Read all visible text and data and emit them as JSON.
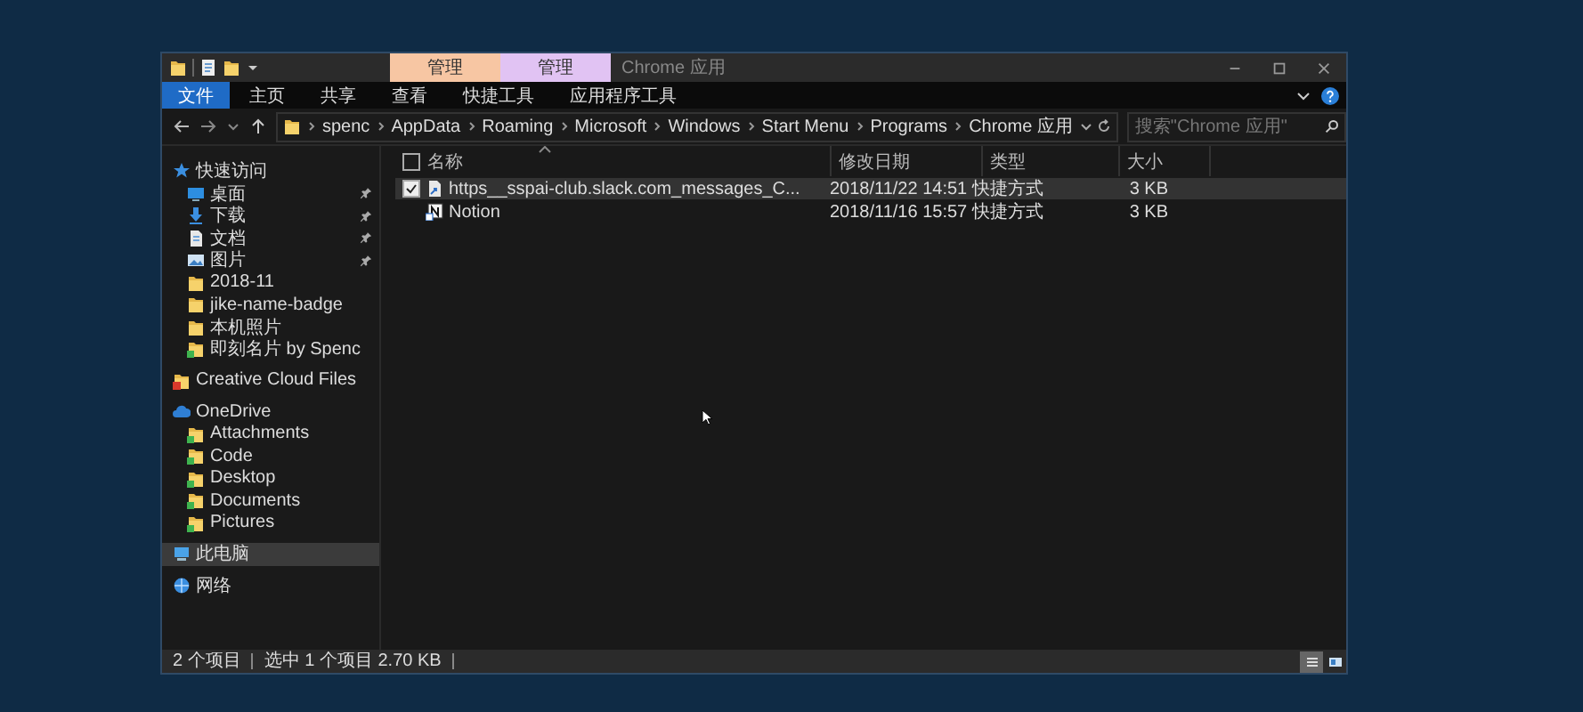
{
  "window": {
    "contextual_tabs": [
      {
        "label": "管理",
        "color": "#f7c6a3"
      },
      {
        "label": "管理",
        "color": "#e1c3f3"
      }
    ],
    "title": "Chrome 应用"
  },
  "ribbon": {
    "tabs": [
      {
        "label": "文件",
        "kind": "file",
        "selected": false
      },
      {
        "label": "主页",
        "kind": "tab",
        "selected": false
      },
      {
        "label": "共享",
        "kind": "tab",
        "selected": false
      },
      {
        "label": "查看",
        "kind": "tab",
        "selected": false
      },
      {
        "label": "快捷工具",
        "kind": "tab",
        "selected": false
      },
      {
        "label": "应用程序工具",
        "kind": "tab",
        "selected": false
      }
    ]
  },
  "address": {
    "path": [
      "spenc",
      "AppData",
      "Roaming",
      "Microsoft",
      "Windows",
      "Start Menu",
      "Programs",
      "Chrome 应用"
    ],
    "search_placeholder": "搜索\"Chrome 应用\""
  },
  "sidebar": {
    "items": [
      {
        "label": "快速访问",
        "kind": "star",
        "selected": false,
        "children": [
          {
            "label": "桌面",
            "kind": "desktop",
            "pinned": true,
            "selected": false
          },
          {
            "label": "下载",
            "kind": "download",
            "pinned": true,
            "selected": false
          },
          {
            "label": "文档",
            "kind": "document",
            "pinned": true,
            "selected": false
          },
          {
            "label": "图片",
            "kind": "image",
            "pinned": true,
            "selected": false
          },
          {
            "label": "2018-11",
            "kind": "folder",
            "pinned": false,
            "selected": false
          },
          {
            "label": "jike-name-badge",
            "kind": "folder",
            "pinned": false,
            "selected": false
          },
          {
            "label": "本机照片",
            "kind": "folder",
            "pinned": false,
            "selected": false
          },
          {
            "label": "即刻名片 by Spenc",
            "kind": "cloud-folder",
            "pinned": false,
            "selected": false
          }
        ]
      },
      {
        "label": "Creative Cloud Files",
        "kind": "cc-folder",
        "selected": false
      },
      {
        "label": "OneDrive",
        "kind": "cloud",
        "selected": false,
        "children": [
          {
            "label": "Attachments",
            "kind": "cloud-folder",
            "pinned": false,
            "selected": false
          },
          {
            "label": "Code",
            "kind": "cloud-folder",
            "pinned": false,
            "selected": false
          },
          {
            "label": "Desktop",
            "kind": "cloud-folder",
            "pinned": false,
            "selected": false
          },
          {
            "label": "Documents",
            "kind": "cloud-folder",
            "pinned": false,
            "selected": false
          },
          {
            "label": "Pictures",
            "kind": "cloud-folder",
            "pinned": false,
            "selected": false
          }
        ]
      },
      {
        "label": "此电脑",
        "kind": "computer",
        "selected": true
      },
      {
        "label": "网络",
        "kind": "network",
        "selected": false
      }
    ]
  },
  "table": {
    "select_all_checked": false,
    "columns": [
      "名称",
      "修改日期",
      "类型",
      "大小"
    ],
    "rows": [
      {
        "name": "https__sspai-club.slack.com_messages_C...",
        "modified": "2018/11/22 14:51",
        "type": "快捷方式",
        "size": "3 KB",
        "kind": "link",
        "selected": true
      },
      {
        "name": "Notion",
        "modified": "2018/11/16 15:57",
        "type": "快捷方式",
        "size": "3 KB",
        "kind": "app",
        "selected": false
      }
    ]
  },
  "status_bar": {
    "count": "2 个项目",
    "selection": "选中 1 个项目  2.70 KB",
    "views": [
      {
        "kind": "details",
        "selected": true
      },
      {
        "kind": "tiles",
        "selected": false
      }
    ]
  }
}
